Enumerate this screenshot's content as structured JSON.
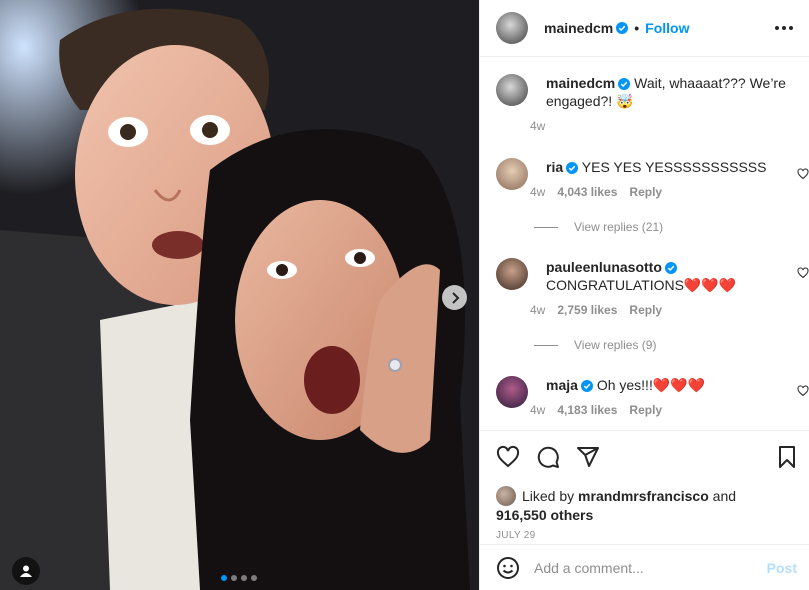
{
  "post": {
    "author": "mainedcm",
    "follow_label": "Follow",
    "separator": "•",
    "caption": {
      "username": "mainedcm",
      "text": "Wait, whaaaat??? We’re engaged?! 🤯",
      "time": "4w"
    }
  },
  "comments": [
    {
      "username": "ria",
      "text": "YES YES YESSSSSSSSSSS",
      "time": "4w",
      "likes": "4,043 likes",
      "reply_label": "Reply",
      "view_replies": "View replies (21)"
    },
    {
      "username": "pauleenlunasotto",
      "text": "CONGRATULATIONS❤️❤️❤️",
      "time": "4w",
      "likes": "2,759 likes",
      "reply_label": "Reply",
      "view_replies": "View replies (9)"
    },
    {
      "username": "maja",
      "text": "Oh yes!!!❤️❤️❤️",
      "time": "4w",
      "likes": "4,183 likes",
      "reply_label": "Reply"
    }
  ],
  "likes": {
    "prefix": "Liked by",
    "user": "mrandmrsfrancisco",
    "conj": "and",
    "count": "916,550 others"
  },
  "date": "JULY 29",
  "add_comment": {
    "placeholder": "Add a comment...",
    "post_label": "Post"
  },
  "carousel": {
    "total": 4,
    "active": 0
  },
  "colors": {
    "accent": "#0095f6",
    "heart": "#ed4956",
    "muted": "#8e8e8e",
    "post_disabled": "#b2dffc"
  },
  "icons": [
    "heart-icon",
    "comment-icon",
    "share-icon",
    "bookmark-icon",
    "emoji-icon",
    "verified-icon",
    "chevron-right-icon",
    "user-tag-icon",
    "more-icon"
  ]
}
